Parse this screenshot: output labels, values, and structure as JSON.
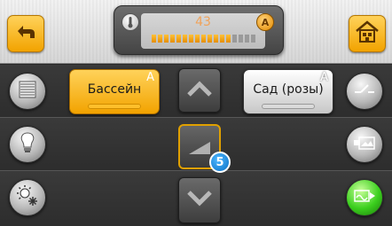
{
  "header": {
    "temperature": "43",
    "level": 0.77,
    "auto_label": "A"
  },
  "rooms": [
    {
      "label": "Бассейн",
      "mode": "A",
      "active": true
    },
    {
      "label": "Сад (розы)",
      "mode": "A",
      "active": false
    }
  ],
  "badge": {
    "count": "5"
  },
  "colors": {
    "accent": "#f2a300",
    "panel": "#2d2d2d",
    "header": "#e5e5e5",
    "badge": "#0a6fc4",
    "active_green": "#3bcf1e"
  },
  "icons": {
    "left_column": [
      "blinds-icon",
      "lightbulb-icon",
      "sun-snow-icon"
    ],
    "right_column": [
      "switch-icon",
      "camera-icon",
      "scene-icon"
    ]
  }
}
